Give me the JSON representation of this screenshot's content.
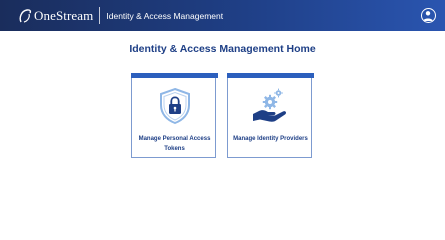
{
  "header": {
    "brand_name": "OneStream",
    "app_title": "Identity & Access Management",
    "user_icon": "user-circle-icon"
  },
  "main": {
    "heading": "Identity & Access Management Home",
    "cards": [
      {
        "label": "Manage Personal Access Tokens",
        "icon": "shield-lock-icon"
      },
      {
        "label": "Manage Identity Providers",
        "icon": "hand-gears-icon"
      }
    ]
  },
  "colors": {
    "header_gradient_start": "#1a2d5c",
    "header_gradient_end": "#2a55b0",
    "accent_blue": "#2c5fbd",
    "heading_text": "#1e3f86",
    "icon_light_blue": "#8fb7e6"
  }
}
